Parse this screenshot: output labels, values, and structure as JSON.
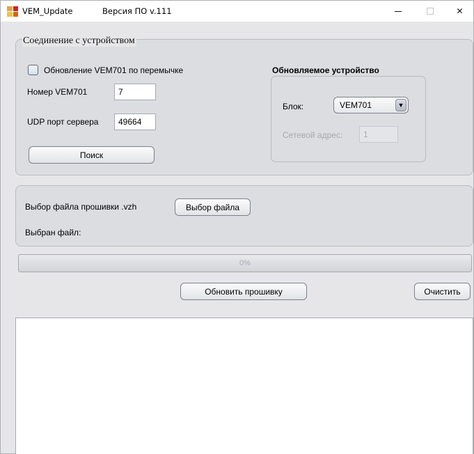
{
  "titlebar": {
    "app_title": "VEM_Update",
    "version": "Версия ПО v.111",
    "minimize_symbol": "",
    "close_symbol": "✕"
  },
  "connection": {
    "legend": "Соединение с устройством",
    "jumper_update_label": "Обновление VEM701 по перемычке",
    "jumper_update_checked": false,
    "vem_number_label": "Номер VEM701",
    "vem_number_value": "7",
    "udp_port_label": "UDP порт сервера",
    "udp_port_value": "49664",
    "search_button": "Поиск"
  },
  "device": {
    "heading": "Обновляемое устройство",
    "block_label": "Блок:",
    "block_selected": "VEM701",
    "network_address_label": "Сетевой адрес:",
    "network_address_value": "1"
  },
  "firmware": {
    "choose_label": "Выбор файла прошивки .vzh",
    "choose_button": "Выбор файла",
    "selected_label": "Выбран файл:"
  },
  "progress": {
    "value": 0,
    "text": "0%"
  },
  "actions": {
    "update_button": "Обновить прошивку",
    "clear_button": "Очистить"
  },
  "colors": {
    "window_bg": "#e6e6e9",
    "panel_bg": "#dcdde1",
    "disabled_text": "#a8a8ad"
  }
}
